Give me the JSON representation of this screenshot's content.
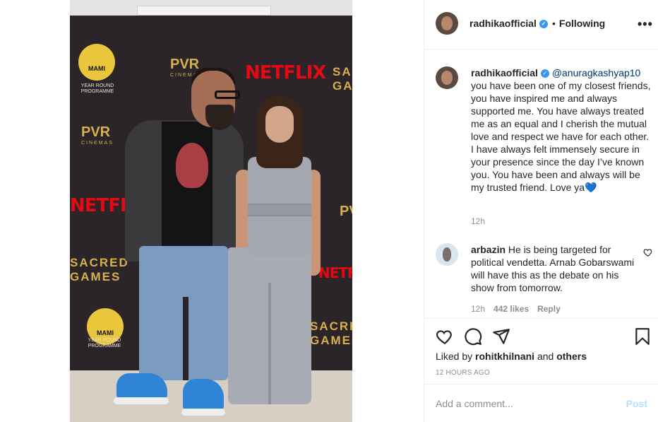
{
  "post": {
    "brand_text": {
      "pvr": "PVR",
      "pvr_sub": "CINEMAS",
      "netflix": "NETFLIX",
      "sacred_games": "SACRED GAMES",
      "mami": "MAMI",
      "mami_caption": "YEAR ROUND PROGRAMME"
    }
  },
  "header": {
    "username": "radhikaofficial",
    "following_label": "Following",
    "more_icon": "more-horizontal-icon"
  },
  "caption": {
    "username": "radhikaofficial",
    "mention": "@anuragkashyap10",
    "text": "you have been one of my closest friends, you have inspired me and always supported me. You have always treated me as an equal and I cherish the mutual love and respect we have for each other. I have always felt immensely secure in your presence since the day I’ve known you. You have been and always will be my trusted friend. Love ya",
    "emoji": "💙",
    "time": "12h"
  },
  "comment": {
    "username": "arbazin",
    "text": "He is being targeted for political vendetta. Arnab Gobarswami will have this as the debate on his show from tomorrow.",
    "time": "12h",
    "likes": "442 likes",
    "reply": "Reply"
  },
  "actions": {
    "liked_by_prefix": "Liked by",
    "liked_by_user": "rohitkhilnani",
    "liked_by_and": "and",
    "liked_by_others": "others",
    "timestamp": "12 HOURS AGO"
  },
  "add_comment": {
    "placeholder": "Add a comment...",
    "post_label": "Post"
  },
  "colors": {
    "verified": "#3897f0",
    "post_disabled": "#b2dffc",
    "mention": "#00376b"
  }
}
